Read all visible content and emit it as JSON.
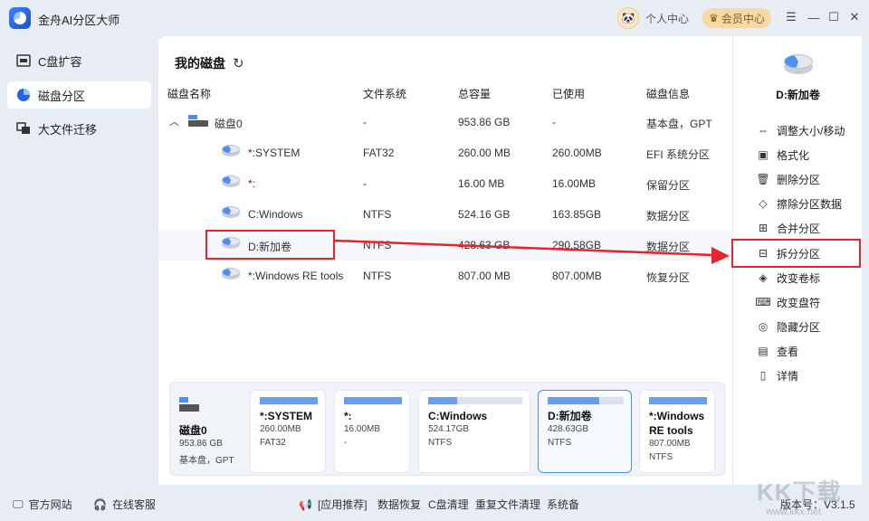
{
  "app": {
    "title": "金舟AI分区大师",
    "user_center": "个人中心",
    "member_center": "会员中心",
    "window_controls": [
      "minimize-icon",
      "restore-icon",
      "close-icon",
      "menu-icon"
    ]
  },
  "sidebar": {
    "items": [
      {
        "label": "C盘扩容",
        "icon": "c-drive-icon",
        "active": false
      },
      {
        "label": "磁盘分区",
        "icon": "pie-chart-icon",
        "active": true
      },
      {
        "label": "大文件迁移",
        "icon": "migrate-icon",
        "active": false
      }
    ]
  },
  "main": {
    "title": "我的磁盘",
    "columns": [
      "磁盘名称",
      "文件系统",
      "总容量",
      "已使用",
      "磁盘信息"
    ],
    "disk": {
      "name": "磁盘0",
      "fs": "-",
      "total": "953.86 GB",
      "used": "-",
      "info": "基本盘，GPT"
    },
    "partitions": [
      {
        "name": "*:SYSTEM",
        "fs": "FAT32",
        "total": "260.00 MB",
        "used": "260.00MB",
        "info": "EFI 系统分区"
      },
      {
        "name": "*:",
        "fs": "-",
        "total": "16.00 MB",
        "used": "16.00MB",
        "info": "保留分区"
      },
      {
        "name": "C:Windows",
        "fs": "NTFS",
        "total": "524.16 GB",
        "used": "163.85GB",
        "info": "数据分区"
      },
      {
        "name": "D:新加卷",
        "fs": "NTFS",
        "total": "428.63 GB",
        "used": "290.58GB",
        "info": "数据分区"
      },
      {
        "name": "*:Windows RE tools",
        "fs": "NTFS",
        "total": "807.00 MB",
        "used": "807.00MB",
        "info": "恢复分区"
      }
    ]
  },
  "cards": {
    "disk": {
      "name": "磁盘0",
      "size": "953.86 GB",
      "type": "基本盘，GPT"
    },
    "partitions": [
      {
        "name_line1": "*:SYSTEM",
        "name_line2": "",
        "size": "260.00MB",
        "fs": "FAT32",
        "fill": 1.0,
        "selected": false
      },
      {
        "name_line1": "*:",
        "name_line2": "",
        "size": "16.00MB",
        "fs": "-",
        "fill": 1.0,
        "selected": false
      },
      {
        "name_line1": "C:Windows",
        "name_line2": "",
        "size": "524.17GB",
        "fs": "NTFS",
        "fill": 0.31,
        "selected": false
      },
      {
        "name_line1": "D:新加卷",
        "name_line2": "",
        "size": "428.63GB",
        "fs": "NTFS",
        "fill": 0.68,
        "selected": true
      },
      {
        "name_line1": "*:Windows",
        "name_line2": "RE tools",
        "size": "807.00MB",
        "fs": "NTFS",
        "fill": 1.0,
        "selected": false
      }
    ]
  },
  "right_panel": {
    "selected": "D:新加卷",
    "actions": [
      {
        "label": "调整大小/移动",
        "icon": "resize-icon"
      },
      {
        "label": "格式化",
        "icon": "format-icon"
      },
      {
        "label": "删除分区",
        "icon": "delete-icon"
      },
      {
        "label": "擦除分区数据",
        "icon": "eraser-icon"
      },
      {
        "label": "合并分区",
        "icon": "merge-icon"
      },
      {
        "label": "拆分分区",
        "icon": "split-icon"
      },
      {
        "label": "改变卷标",
        "icon": "label-icon"
      },
      {
        "label": "改变盘符",
        "icon": "drive-letter-icon"
      },
      {
        "label": "隐藏分区",
        "icon": "hide-icon"
      },
      {
        "label": "查看",
        "icon": "view-icon"
      },
      {
        "label": "详情",
        "icon": "details-icon"
      }
    ]
  },
  "statusbar": {
    "website": "官方网站",
    "support": "在线客服",
    "recommend": "[应用推荐]",
    "links": [
      "数据恢复",
      "C盘清理",
      "重复文件清理",
      "系统备"
    ],
    "version": "版本号：V3.1.5"
  },
  "watermark": {
    "brand": "KK下载",
    "url": "www.kkx.net"
  },
  "colors": {
    "accent": "#4b8ff0",
    "highlight_box": "#e8242a",
    "background": "#e8edf4"
  }
}
